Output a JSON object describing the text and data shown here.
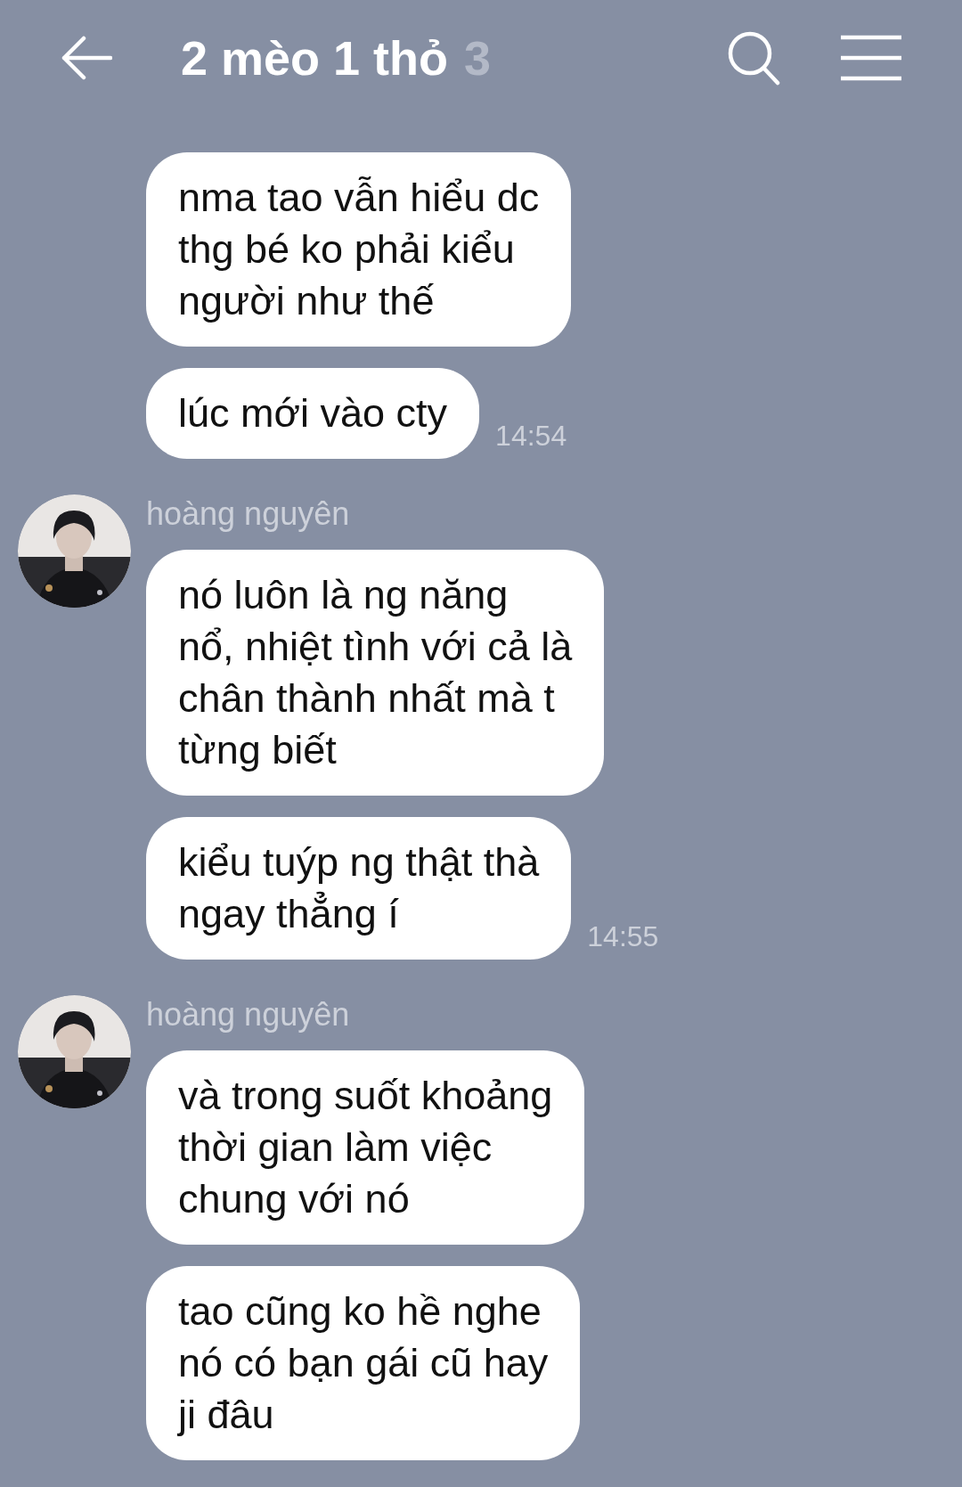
{
  "header": {
    "title": "2 mèo 1 thỏ",
    "member_count": "3"
  },
  "groups": [
    {
      "messages": [
        {
          "text": "nma tao vẫn hiểu dc\nthg bé ko phải kiểu\nngười như thế"
        },
        {
          "text": "lúc mới vào cty",
          "time": "14:54"
        }
      ]
    },
    {
      "sender": "hoàng nguyên",
      "messages": [
        {
          "text": "nó luôn là ng năng\nnổ, nhiệt tình với cả là\nchân thành nhất mà t\ntừng biết"
        },
        {
          "text": "kiểu tuýp ng thật thà\nngay thẳng í",
          "time": "14:55"
        }
      ]
    },
    {
      "sender": "hoàng nguyên",
      "messages": [
        {
          "text": "và trong suốt khoảng\nthời gian làm việc\nchung với nó"
        },
        {
          "text": "tao cũng ko hề nghe\nnó có bạn gái cũ hay\nji đâu"
        }
      ]
    }
  ]
}
